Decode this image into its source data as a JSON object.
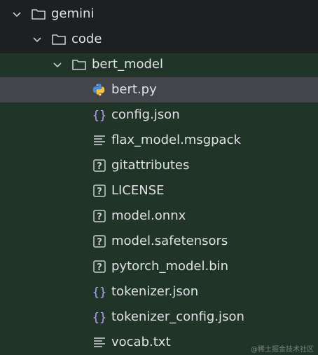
{
  "tree": {
    "folders": [
      {
        "name": "gemini",
        "icon": "folder-icon",
        "expanded": true
      },
      {
        "name": "code",
        "icon": "folder-icon",
        "expanded": true
      },
      {
        "name": "bert_model",
        "icon": "folder-icon",
        "expanded": true
      }
    ],
    "files": [
      {
        "name": "bert.py",
        "icon": "python-file-icon",
        "selected": true
      },
      {
        "name": "config.json",
        "icon": "json-file-icon"
      },
      {
        "name": "flax_model.msgpack",
        "icon": "text-file-icon"
      },
      {
        "name": "gitattributes",
        "icon": "unknown-file-icon"
      },
      {
        "name": "LICENSE",
        "icon": "unknown-file-icon"
      },
      {
        "name": "model.onnx",
        "icon": "unknown-file-icon"
      },
      {
        "name": "model.safetensors",
        "icon": "unknown-file-icon"
      },
      {
        "name": "pytorch_model.bin",
        "icon": "unknown-file-icon"
      },
      {
        "name": "tokenizer.json",
        "icon": "json-file-icon"
      },
      {
        "name": "tokenizer_config.json",
        "icon": "json-file-icon"
      },
      {
        "name": "vocab.txt",
        "icon": "text-file-icon"
      }
    ]
  },
  "watermark": "@稀土掘金技术社区",
  "colors": {
    "background": "#1e1f22",
    "highlight_background": "#213428",
    "selection": "#43454a",
    "text": "#dfe1e5",
    "json_brace": "#b39cff"
  }
}
